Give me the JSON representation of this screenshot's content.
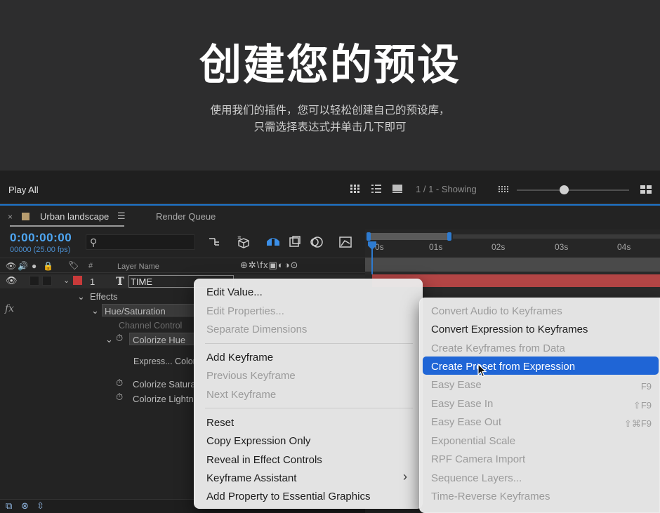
{
  "hero": {
    "title": "创建您的预设",
    "subtitle_line1": "使用我们的插件，您可以轻松创建自己的预设库，",
    "subtitle_line2": "只需选择表达式并单击几下即可"
  },
  "toolbar": {
    "play_all": "Play All",
    "showing": "1 / 1 - Showing",
    "zoom_level": 0.42
  },
  "tabs": {
    "comp_label": "Urban landscape",
    "menu_glyph": "☰",
    "close_glyph": "×",
    "render_queue": "Render Queue"
  },
  "timeline": {
    "timecode": "0:00:00:00",
    "frames": "00000 (25.00 fps)",
    "ruler_labels": [
      "0s",
      "01s",
      "02s",
      "03s",
      "04s"
    ],
    "columns": {
      "hash": "#",
      "layer_name": "Layer Name",
      "switches": "⊕✲\\fx▣◐◑⊙"
    },
    "layer": {
      "number": "1",
      "type_glyph": "T",
      "name": "TIME",
      "label_color": "#c83a3a"
    },
    "tree": {
      "effects": "Effects",
      "hue_saturation": "Hue/Saturation",
      "channel_control": "Channel Control",
      "colorize_hue": "Colorize Hue",
      "expression": "Express... Color",
      "colorize_saturation": "Colorize Satura",
      "colorize_lightness": "Colorize Lightn"
    },
    "fx_label": "fx"
  },
  "context_menu": {
    "edit_value": "Edit Value...",
    "edit_properties": "Edit Properties...",
    "separate_dimensions": "Separate Dimensions",
    "add_keyframe": "Add Keyframe",
    "previous_keyframe": "Previous Keyframe",
    "next_keyframe": "Next Keyframe",
    "reset": "Reset",
    "copy_expression_only": "Copy Expression Only",
    "reveal_in_effect_controls": "Reveal in Effect Controls",
    "keyframe_assistant": "Keyframe Assistant",
    "add_property_to_essential_graphics": "Add Property to Essential Graphics",
    "submenu_arrow": "›"
  },
  "submenu": {
    "convert_audio": "Convert Audio to Keyframes",
    "convert_expression": "Convert Expression to Keyframes",
    "create_from_data": "Create Keyframes from Data",
    "create_preset": "Create Preset from Expression",
    "easy_ease": "Easy Ease",
    "easy_ease_shortcut": "F9",
    "easy_ease_in": "Easy Ease In",
    "easy_ease_in_shortcut": "⇧F9",
    "easy_ease_out": "Easy Ease Out",
    "easy_ease_out_shortcut": "⇧⌘F9",
    "exponential_scale": "Exponential Scale",
    "rpf_camera_import": "RPF Camera Import",
    "sequence_layers": "Sequence Layers...",
    "time_reverse": "Time-Reverse Keyframes"
  },
  "colors": {
    "accent_blue": "#1f65d6",
    "timecode_blue": "#4ea6f2",
    "layer_bar_red": "#b34545"
  }
}
